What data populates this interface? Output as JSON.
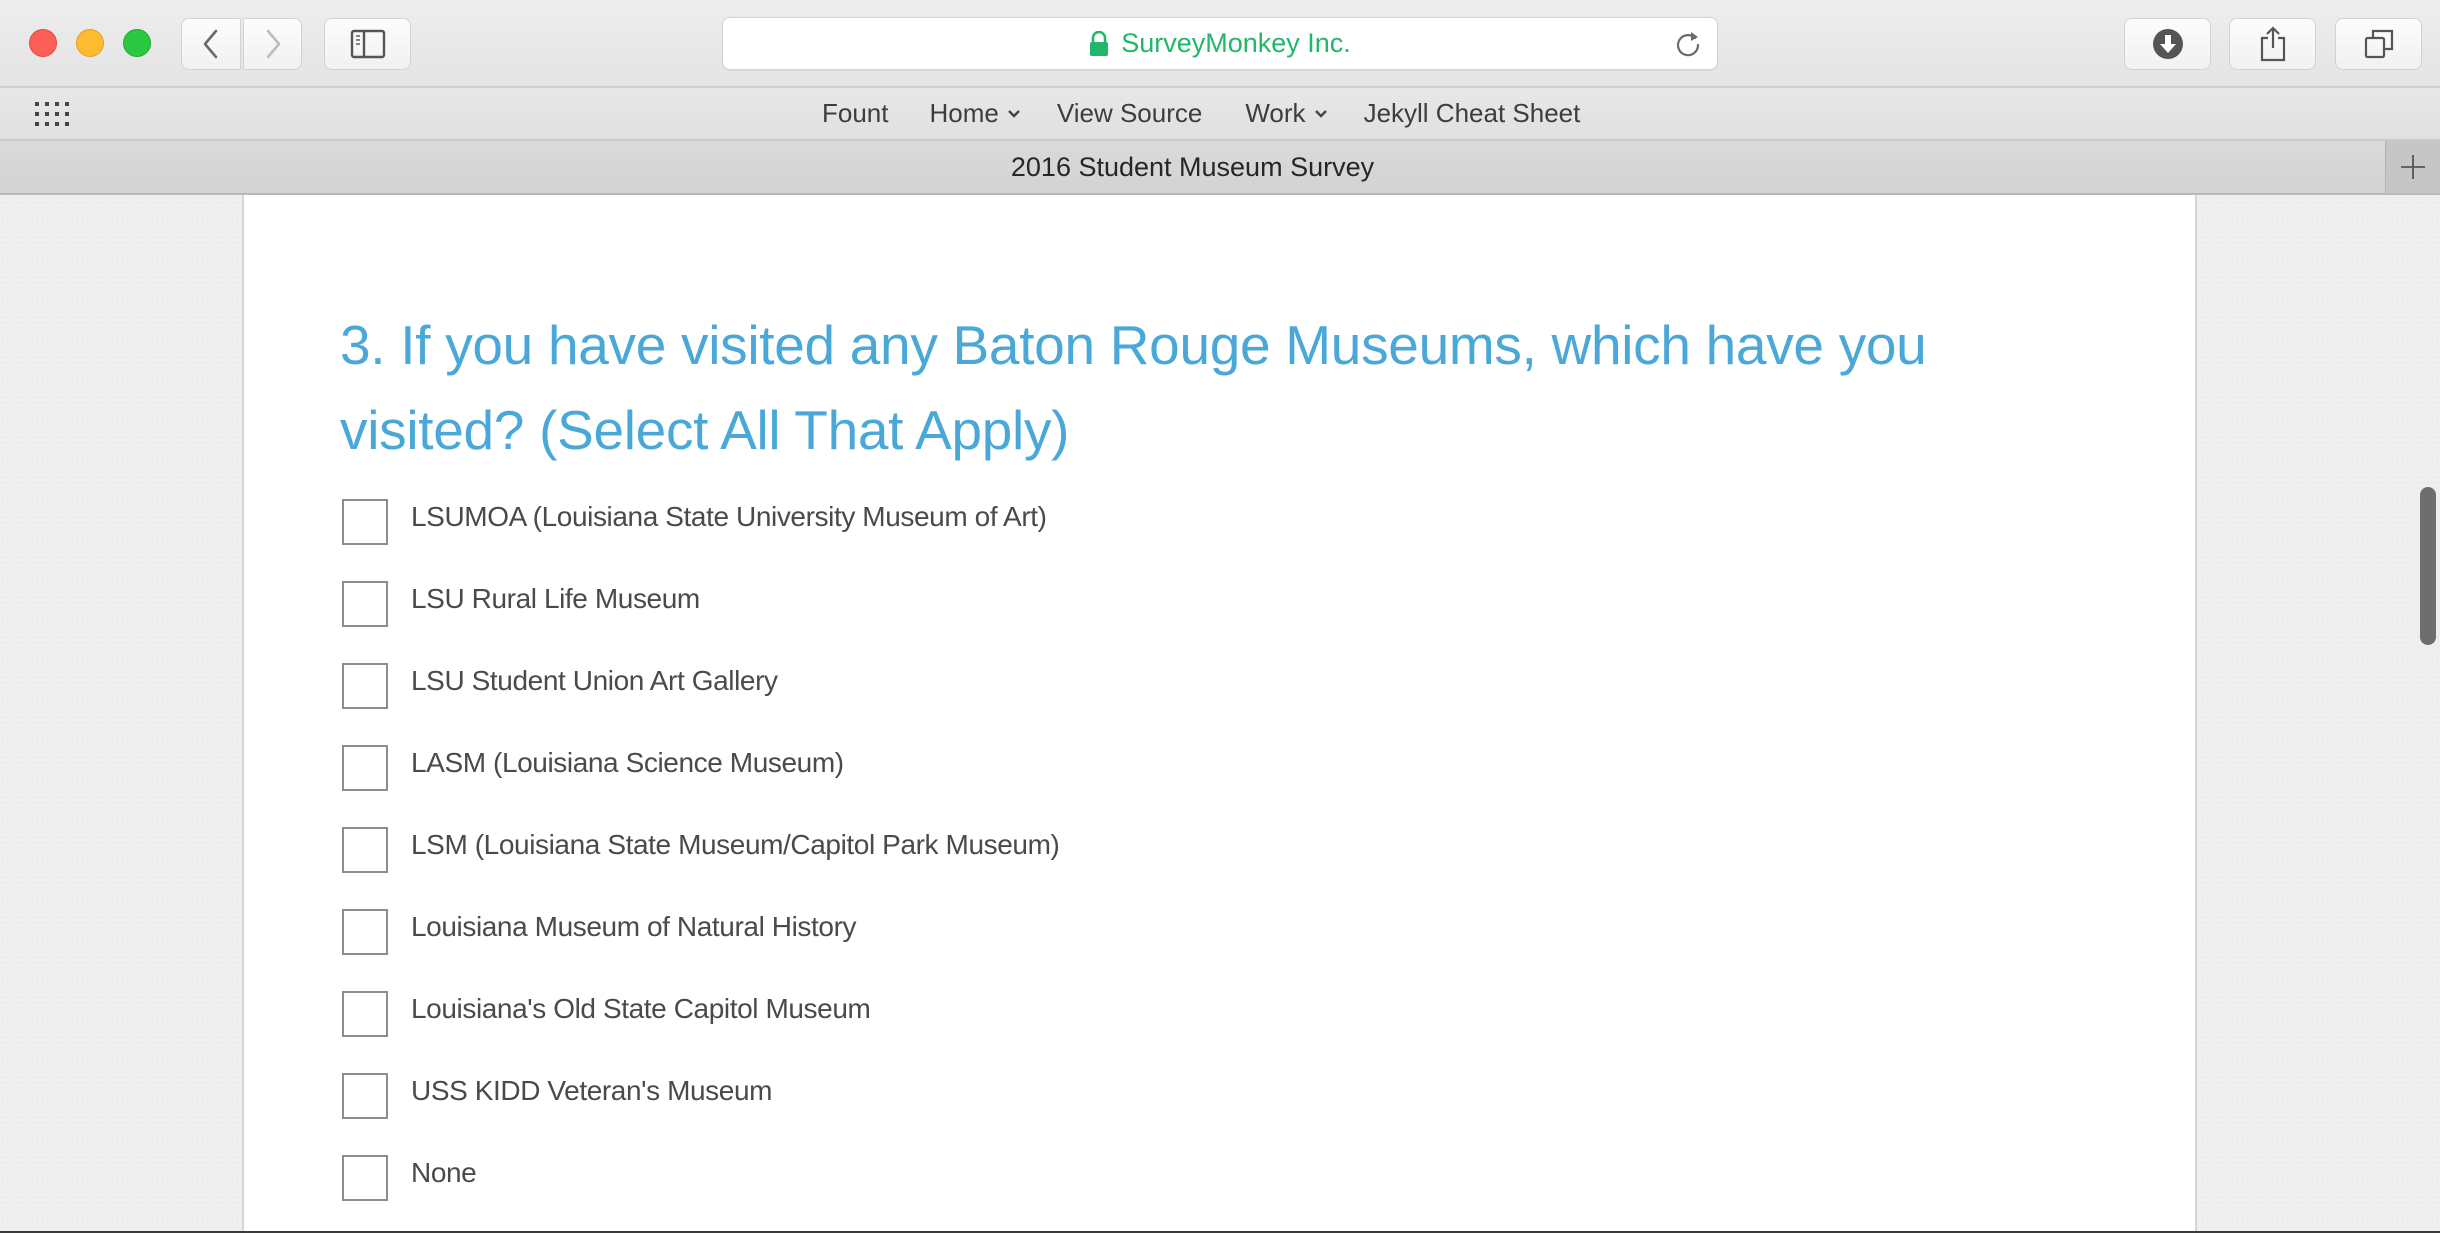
{
  "window": {
    "controls": [
      "close",
      "minimize",
      "zoom"
    ]
  },
  "toolbar": {
    "back_icon": "chevron-left-icon",
    "forward_icon": "chevron-right-icon",
    "sidebar_icon": "sidebar-icon",
    "address": {
      "secure_icon": "lock-icon",
      "site_label": "SurveyMonkey Inc.",
      "reload_icon": "reload-icon",
      "site_color": "#1fb86a"
    },
    "downloads_icon": "download-icon",
    "share_icon": "share-icon",
    "tabs_icon": "tab-overview-icon"
  },
  "bookmarks": {
    "apps_icon": "grid-icon",
    "items": [
      {
        "label": "Fount",
        "has_menu": false
      },
      {
        "label": "Home",
        "has_menu": true
      },
      {
        "label": "View Source",
        "has_menu": false
      },
      {
        "label": "Work",
        "has_menu": true
      },
      {
        "label": "Jekyll Cheat Sheet",
        "has_menu": false
      }
    ]
  },
  "tabbar": {
    "active_tab_title": "2016 Student Museum Survey",
    "new_tab_icon": "plus-icon"
  },
  "survey": {
    "question": "3. If you have visited any Baton Rouge Museums, which have you visited? (Select All That Apply)",
    "title_color": "#4aa8d8",
    "options": [
      {
        "label": "LSUMOA (Louisiana State University Museum of Art)",
        "checked": false
      },
      {
        "label": "LSU Rural Life Museum",
        "checked": false
      },
      {
        "label": "LSU Student Union Art Gallery",
        "checked": false
      },
      {
        "label": "LASM (Louisiana Science Museum)",
        "checked": false
      },
      {
        "label": "LSM (Louisiana State Museum/Capitol Park Museum)",
        "checked": false
      },
      {
        "label": "Louisiana Museum of Natural History",
        "checked": false
      },
      {
        "label": "Louisiana's Old State Capitol Museum",
        "checked": false
      },
      {
        "label": "USS KIDD Veteran's Museum",
        "checked": false
      },
      {
        "label": "None",
        "checked": false
      }
    ]
  }
}
